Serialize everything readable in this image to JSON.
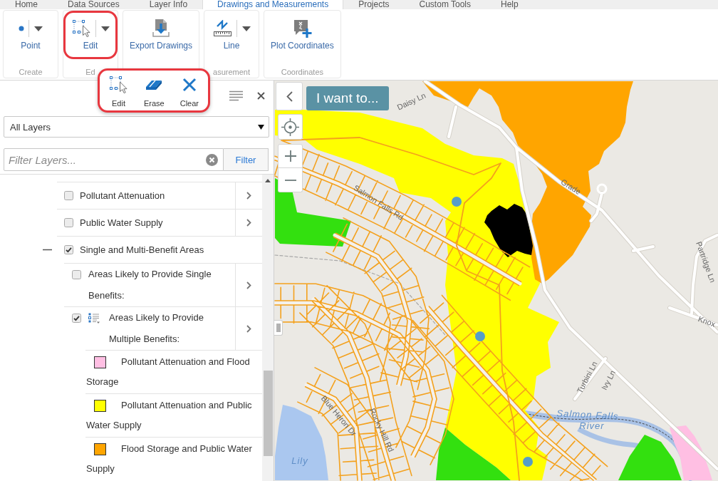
{
  "tabs": [
    {
      "label": "Home",
      "selected": false
    },
    {
      "label": "Data Sources",
      "selected": false
    },
    {
      "label": "Layer Info",
      "selected": false
    },
    {
      "label": "Drawings and Measurements",
      "selected": true
    },
    {
      "label": "Projects",
      "selected": false
    },
    {
      "label": "Custom Tools",
      "selected": false
    },
    {
      "label": "Help",
      "selected": false
    }
  ],
  "ribbon": {
    "groups": [
      {
        "label": "Create",
        "buttons": [
          {
            "kind": "point",
            "label": "Point",
            "dropdown": true,
            "highlighted": false
          }
        ]
      },
      {
        "label": "Ed",
        "buttons": [
          {
            "kind": "edit",
            "label": "Edit",
            "dropdown": true,
            "highlighted": true
          }
        ]
      },
      {
        "buttons": [
          {
            "kind": "export",
            "label": "Export Drawings",
            "dropdown": false,
            "highlighted": false
          }
        ]
      },
      {
        "label": "asurement",
        "buttons": [
          {
            "kind": "line",
            "label": "Line",
            "dropdown": true,
            "highlighted": false
          }
        ]
      },
      {
        "label": "Coordinates",
        "buttons": [
          {
            "kind": "plot",
            "label": "Plot Coordinates",
            "dropdown": false,
            "highlighted": false
          }
        ]
      }
    ]
  },
  "edit_menu": {
    "highlighted": true,
    "items": [
      {
        "kind": "edit",
        "label": "Edit"
      },
      {
        "kind": "erase",
        "label": "Erase"
      },
      {
        "kind": "clear",
        "label": "Clear"
      }
    ]
  },
  "layers_panel": {
    "layer_scope": {
      "value": "All Layers"
    },
    "filter": {
      "placeholder": "Filter Layers...",
      "button": "Filter"
    },
    "tree": [
      {
        "label": "Pollutant Attenuation",
        "checked": false,
        "has_details": true
      },
      {
        "label": "Public Water Supply",
        "checked": false,
        "has_details": true
      },
      {
        "label": "Single and Multi-Benefit Areas",
        "checked": true,
        "has_details": false,
        "expanded": true,
        "children": [
          {
            "label": "Areas Likely to Provide Single Benefits:",
            "checked": false,
            "has_details": true
          },
          {
            "label": "Areas Likely to Provide Multiple Benefits:",
            "checked": true,
            "has_details": true,
            "legend": [
              {
                "label": "Pollutant Attenuation and Flood Storage",
                "color": "#ffbfe3"
              },
              {
                "label": "Pollutant Attenuation and Public Water Supply",
                "color": "#ffff00"
              },
              {
                "label": "Flood Storage and Public Water Supply",
                "color": "#ffa500"
              }
            ]
          }
        ]
      }
    ]
  },
  "map": {
    "action_button": "I want to...",
    "labels": [
      {
        "kind": "street",
        "text": "Daisy Ln"
      },
      {
        "kind": "street",
        "text": "Grade"
      },
      {
        "kind": "street",
        "text": "Salmon Falls Rd"
      },
      {
        "kind": "street",
        "text": "Partridge Ln"
      },
      {
        "kind": "street",
        "text": "Knox"
      },
      {
        "kind": "street",
        "text": "Turbini Ln"
      },
      {
        "kind": "street",
        "text": "Ivy Ln"
      },
      {
        "kind": "water",
        "text": "Salmon Falls"
      },
      {
        "kind": "street",
        "text": "Blue Heron Dr"
      },
      {
        "kind": "water",
        "text": "River"
      },
      {
        "kind": "street",
        "text": "Rocky Hill Rd"
      },
      {
        "kind": "water",
        "text": "Lily"
      }
    ]
  }
}
